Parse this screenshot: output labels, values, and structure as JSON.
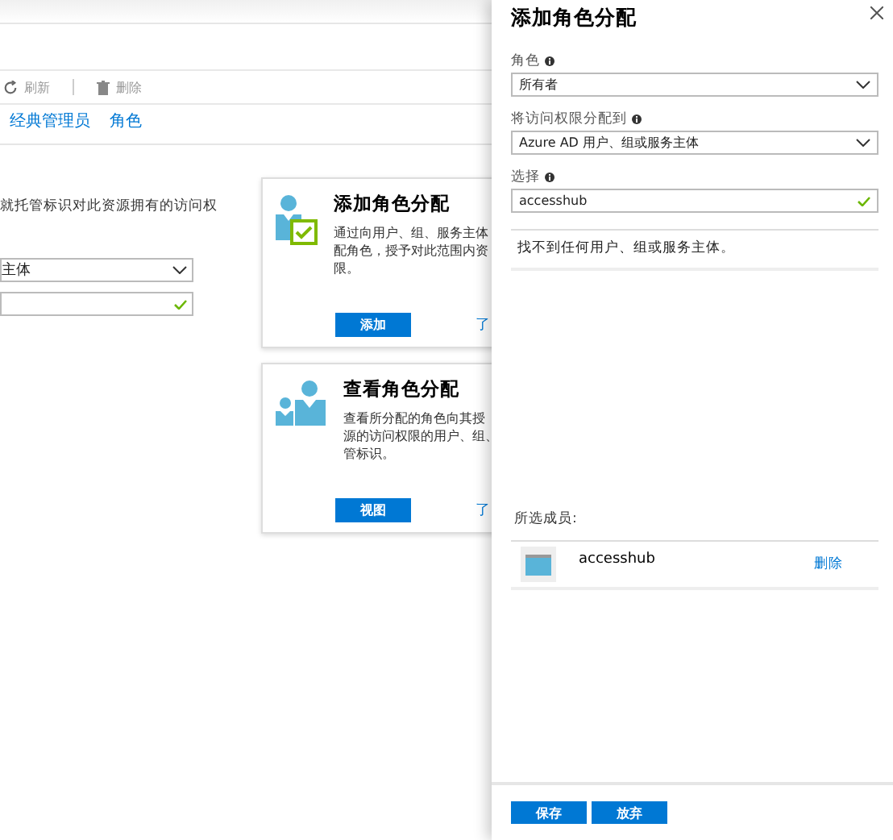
{
  "toolbar": [
    {
      "kind": "refresh",
      "label": "刷新"
    },
    {
      "kind": "delete",
      "label": "删除"
    }
  ],
  "tabs": [
    {
      "label": "经典管理员",
      "selected": false
    },
    {
      "label": "角色",
      "selected": false
    }
  ],
  "description": "就托管标识对此资源拥有的访问权",
  "left_fields": [
    {
      "kind": "dropdown",
      "value": "主体"
    },
    {
      "kind": "check"
    }
  ],
  "cards": [
    {
      "kind": "add",
      "title": "添加角色分配",
      "lines": [
        "通过向用户、组、服务主体",
        "配角色，授予对此范围内资",
        "限。"
      ],
      "button": "添加",
      "link": "了"
    },
    {
      "kind": "view",
      "title": "查看角色分配",
      "lines": [
        "查看所分配的角色向其授",
        "源的访问权限的用户、组、",
        "管标识。"
      ],
      "button": "视图",
      "link": "了"
    }
  ],
  "panel": {
    "title": "添加角色分配",
    "fields": [
      {
        "label": "角色",
        "kind": "dropdown",
        "value": "所有者"
      },
      {
        "label": "将访问权限分配到",
        "kind": "dropdown",
        "value": "Azure AD 用户、组或服务主体"
      },
      {
        "label": "选择",
        "kind": "check",
        "value": "accesshub"
      }
    ],
    "no_result": "找不到任何用户、组或服务主体。",
    "selected_label": "所选成员:",
    "members": [
      {
        "name": "accesshub",
        "action": "删除"
      }
    ],
    "buttons": [
      "保存",
      "放弃"
    ]
  }
}
